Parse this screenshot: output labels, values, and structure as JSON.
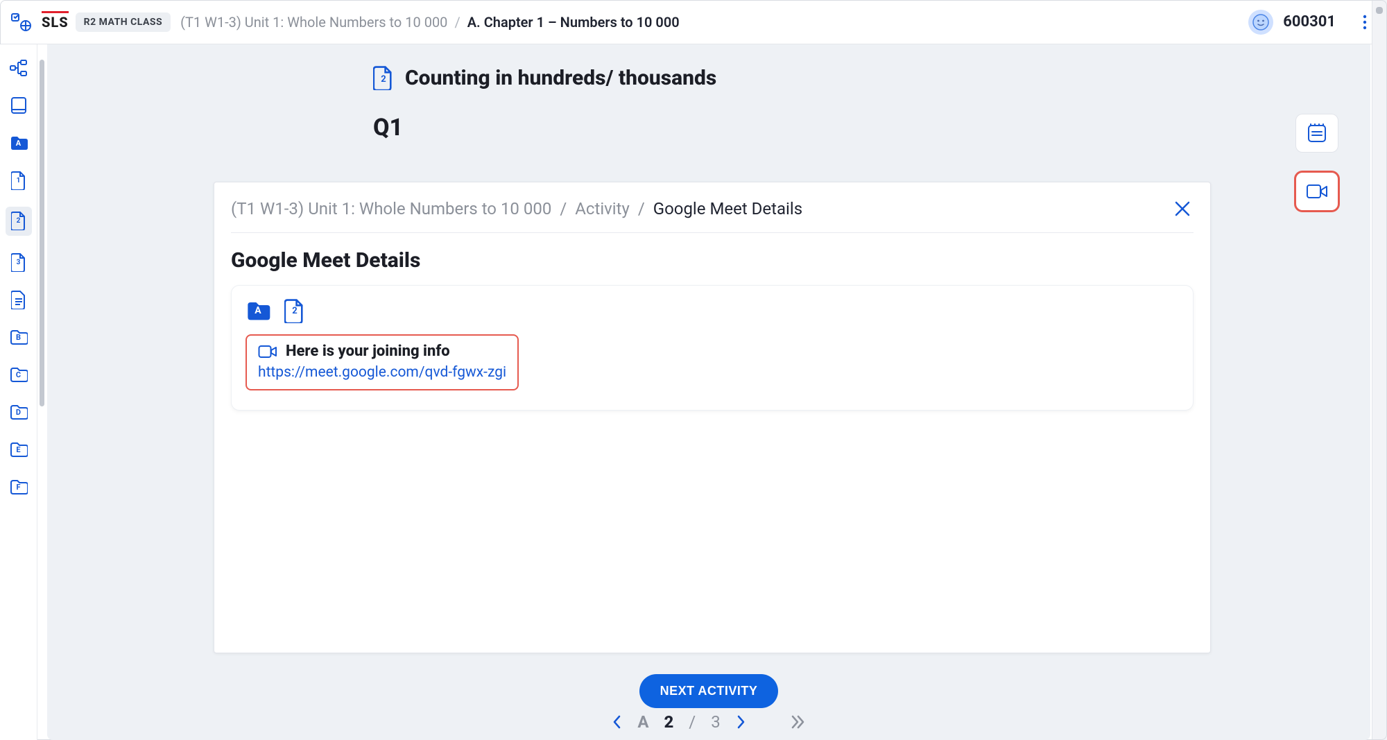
{
  "header": {
    "logo": "SLS",
    "class_badge": "R2 MATH CLASS",
    "crumb_unit": "(T1 W1-3) Unit 1: Whole Numbers to 10 000",
    "crumb_chapter": "A. Chapter 1 – Numbers to 10 000",
    "user_id": "600301"
  },
  "rail": {
    "folder_a": "A",
    "page_1": "1",
    "page_2": "2",
    "page_3": "3",
    "folder_b": "B",
    "folder_c": "C",
    "folder_d": "D",
    "folder_e": "E",
    "folder_f": "F"
  },
  "page": {
    "title_icon_num": "2",
    "title": "Counting in hundreds/ thousands",
    "question_label": "Q1"
  },
  "panel": {
    "crumb_unit": "(T1 W1-3) Unit 1: Whole Numbers to 10 000",
    "crumb_activity": "Activity",
    "crumb_current": "Google Meet Details",
    "heading": "Google Meet Details",
    "chip_folder": "A",
    "chip_page": "2",
    "join_title": "Here is your joining info",
    "join_link": "https://meet.google.com/qvd-fgwx-zgi"
  },
  "footer": {
    "next_label": "NEXT ACTIVITY",
    "section_letter": "A",
    "current_page": "2",
    "total_pages": "3"
  }
}
